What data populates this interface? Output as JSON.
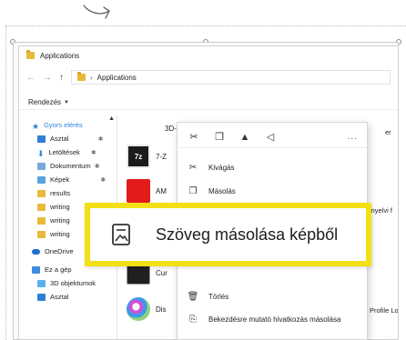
{
  "window": {
    "title": "Applications",
    "breadcrumb": [
      "Applications"
    ],
    "ribbon_label": "Rendezés"
  },
  "sidebar": {
    "items": [
      {
        "label": "Gyors elérés",
        "icon": "star-icon"
      },
      {
        "label": "Asztal",
        "icon": "desktop-icon",
        "pinned": true
      },
      {
        "label": "Letöltések",
        "icon": "download-icon",
        "pinned": true
      },
      {
        "label": "Dokumentum",
        "icon": "document-icon",
        "pinned": true
      },
      {
        "label": "Képek",
        "icon": "pictures-icon",
        "pinned": true
      },
      {
        "label": "results",
        "icon": "folder-icon"
      },
      {
        "label": "writing",
        "icon": "folder-icon"
      },
      {
        "label": "writing",
        "icon": "folder-icon"
      },
      {
        "label": "writing",
        "icon": "folder-icon"
      },
      {
        "label": "OneDrive",
        "icon": "cloud-icon"
      },
      {
        "label": "Ez a gép",
        "icon": "pc-icon"
      },
      {
        "label": "3D objektumok",
        "icon": "cube-icon"
      },
      {
        "label": "Asztal",
        "icon": "desktop-icon"
      }
    ]
  },
  "content": {
    "files": [
      {
        "label": "3D-",
        "thumb": "none"
      },
      {
        "label": "7-Z",
        "thumb": "7z",
        "thumb_text": "7z"
      },
      {
        "label": "AM",
        "thumb": "amd"
      },
      {
        "label": "Cur",
        "thumb": "cur"
      },
      {
        "label": "Dis",
        "thumb": "disk"
      }
    ],
    "right_labels": [
      "er",
      "212 nyelvi f",
      "Profile Loa"
    ]
  },
  "context_menu": {
    "quick_icons": [
      "cut-icon",
      "copy-icon",
      "rename-icon",
      "share-icon"
    ],
    "more_label": "...",
    "items": [
      {
        "label": "Kivágás",
        "icon": "scissors-icon"
      },
      {
        "label": "Másolás",
        "icon": "copy-icon"
      },
      {
        "label": "Törlés",
        "icon": "trash-icon"
      },
      {
        "label": "Bekezdésre mutató hivatkozás másolása",
        "icon": "link-icon"
      }
    ]
  },
  "callout": {
    "label": "Szöveg másolása képből",
    "icon": "image-text-icon",
    "border_color": "#f2df16"
  }
}
